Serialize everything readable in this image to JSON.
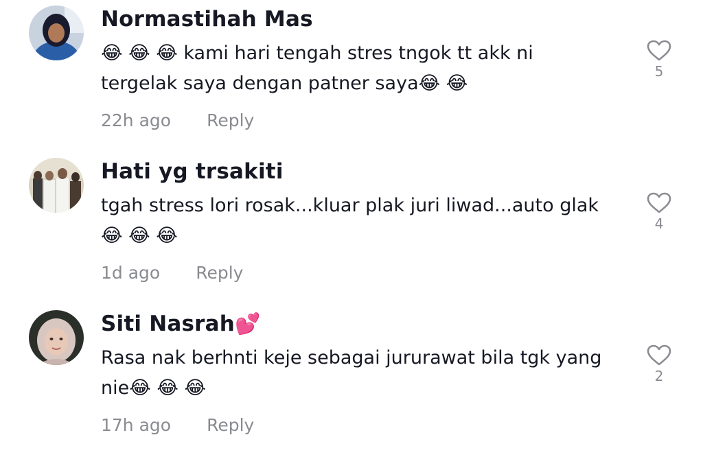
{
  "comments": [
    {
      "username": "Normastihah Mas",
      "username_suffix": "",
      "text_lines": [
        "😂 😂 😂  kami hari tengah stres tngok tt akk ni",
        "tergelak saya dengan patner saya😂 😂"
      ],
      "time": "22h ago",
      "reply_label": "Reply",
      "likes": "5",
      "avatar_icon": "user-avatar",
      "avatar_colors": [
        "#2a5fa8",
        "#1a1a2e"
      ]
    },
    {
      "username": "Hati yg trsakiti",
      "username_suffix": "",
      "text_lines": [
        "tgah stress lori rosak...kluar plak juri liwad...auto glak",
        "😂 😂 😂"
      ],
      "time": "1d ago",
      "reply_label": "Reply",
      "likes": "4",
      "avatar_icon": "user-avatar",
      "avatar_colors": [
        "#d9d2c2",
        "#4a3b30"
      ]
    },
    {
      "username": "Siti Nasrah",
      "username_suffix": "💕",
      "text_lines": [
        "Rasa nak berhnti keje sebagai jururawat bila tgk yang",
        "nie😂 😂 😂"
      ],
      "time": "17h ago",
      "reply_label": "Reply",
      "likes": "2",
      "avatar_icon": "user-avatar",
      "avatar_colors": [
        "#2b2f2a",
        "#e8c9b8"
      ]
    }
  ],
  "colors": {
    "text": "#161823",
    "secondary": "#8a8b91",
    "background": "#ffffff"
  },
  "icons": {
    "like": "heart-outline-icon"
  }
}
